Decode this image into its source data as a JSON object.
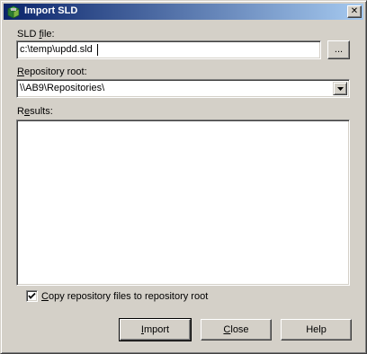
{
  "window": {
    "title": "Import SLD",
    "close_glyph": "✕"
  },
  "sld_file": {
    "label_first": "SLD ",
    "label_accel": "f",
    "label_rest": "ile:",
    "value": "c:\\temp\\updd.sld",
    "browse_label": "..."
  },
  "repository_root": {
    "label_accel": "R",
    "label_rest": "epository root:",
    "selected": "\\\\AB9\\Repositories\\"
  },
  "results": {
    "label_first": "R",
    "label_accel": "e",
    "label_rest": "sults:",
    "content": ""
  },
  "copy_option": {
    "checked": true,
    "label_accel": "C",
    "label_rest": "opy repository files to repository root"
  },
  "buttons": {
    "import": {
      "accel": "I",
      "rest": "mport"
    },
    "close": {
      "accel": "C",
      "rest": "lose"
    },
    "help": {
      "label": "Help"
    }
  }
}
